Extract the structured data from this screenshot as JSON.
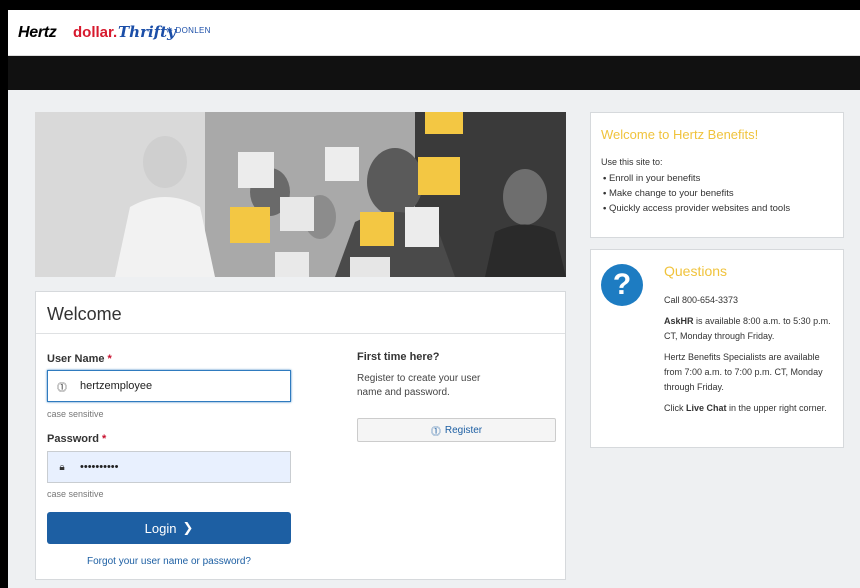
{
  "brands": {
    "hertz": "Hertz",
    "dollar": "dollar.",
    "thrifty": "Thrifty",
    "donlen": "DONLEN"
  },
  "colors": {
    "accent_blue": "#1d5fa3",
    "accent_yellow": "#f0c33c",
    "required_red": "#c8102e",
    "navbar": "#111111"
  },
  "login": {
    "title": "Welcome",
    "username_label": "User Name",
    "username_value": "hertzemployee",
    "username_hint": "case sensitive",
    "password_label": "Password",
    "password_value": "••••••••••",
    "password_hint": "case sensitive",
    "required_mark": "*",
    "login_button": "Login",
    "login_icon": "chevron-right-icon",
    "forgot_link": "Forgot your user name or password?"
  },
  "register": {
    "title": "First time here?",
    "text": "Register to create your user name and password.",
    "button": "Register",
    "button_icon": "user-icon"
  },
  "benefits": {
    "title": "Welcome to Hertz Benefits!",
    "intro": "Use this site to:",
    "items": [
      "Enroll in your benefits",
      "Make change to your benefits",
      "Quickly access provider websites and tools"
    ]
  },
  "questions": {
    "title": "Questions",
    "icon": "question-mark-icon",
    "call": "Call 800-654-3373",
    "askhr_bold": "AskHR",
    "askhr_text": " is available 8:00 a.m. to 5:30 p.m. CT, Monday through Friday.",
    "specialists": "Hertz Benefits Specialists are available from 7:00 a.m. to 7:00 p.m. CT, Monday through Friday.",
    "click_pre": "Click ",
    "click_bold": "Live Chat",
    "click_post": " in the upper right corner."
  }
}
